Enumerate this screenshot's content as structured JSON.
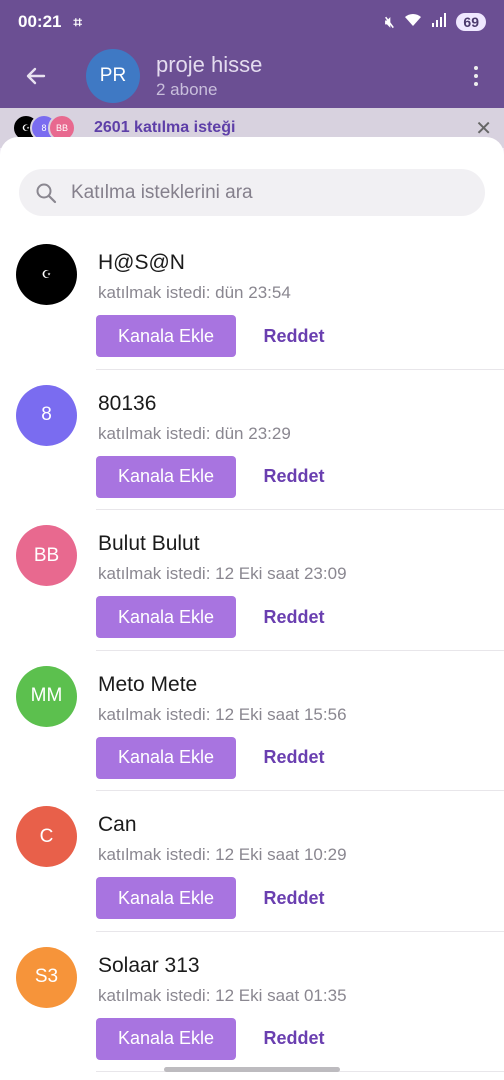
{
  "status_bar": {
    "time": "00:21",
    "battery": "69"
  },
  "channel": {
    "avatar_initials": "PR",
    "avatar_color": "#3f79c4",
    "title": "proje hisse",
    "subtitle": "2 abone"
  },
  "banner": {
    "avatars": [
      {
        "label": "☪",
        "color": "#000000"
      },
      {
        "label": "8",
        "color": "#7a6cf0"
      },
      {
        "label": "BB",
        "color": "#e8698f"
      }
    ],
    "text": "2601 katılma isteği"
  },
  "search": {
    "placeholder": "Katılma isteklerini ara"
  },
  "labels": {
    "add": "Kanala Ekle",
    "reject": "Reddet"
  },
  "requests": [
    {
      "initials": "☪",
      "color": "#000000",
      "name": "H@S@N",
      "time": "katılmak istedi: dün 23:54"
    },
    {
      "initials": "8",
      "color": "#7a6cf0",
      "name": "80136",
      "time": "katılmak istedi: dün 23:29"
    },
    {
      "initials": "BB",
      "color": "#e8698f",
      "name": "Bulut Bulut",
      "time": "katılmak istedi: 12 Eki saat 23:09"
    },
    {
      "initials": "MM",
      "color": "#5cc04e",
      "name": "Meto Mete",
      "time": "katılmak istedi: 12 Eki saat 15:56"
    },
    {
      "initials": "C",
      "color": "#e8604a",
      "name": "Can",
      "time": "katılmak istedi: 12 Eki saat 10:29"
    },
    {
      "initials": "S3",
      "color": "#f6943a",
      "name": "Solaar 313",
      "time": "katılmak istedi: 12 Eki saat 01:35"
    }
  ]
}
